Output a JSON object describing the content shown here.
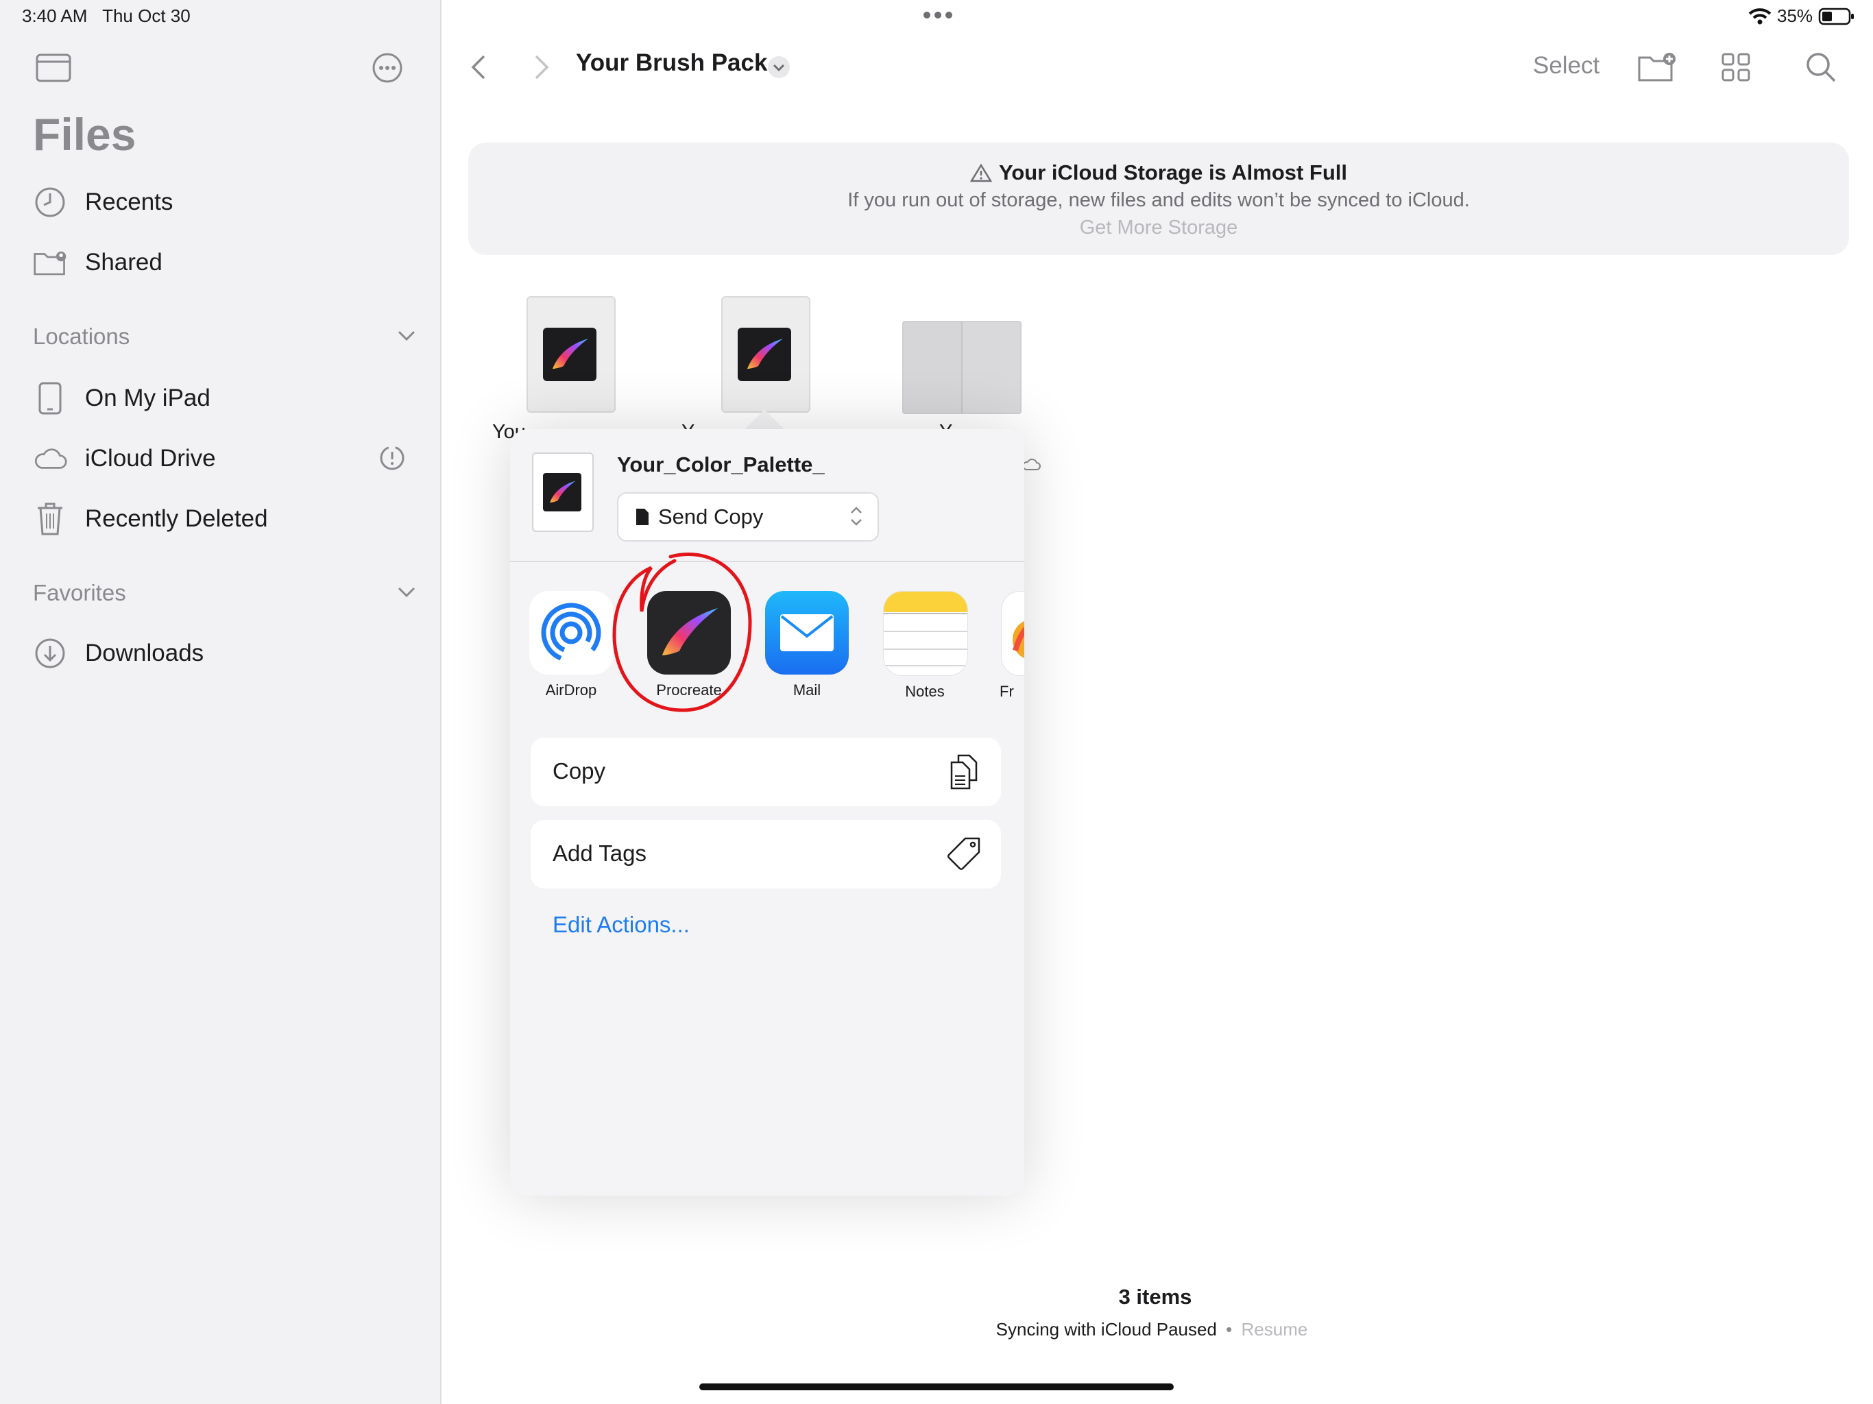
{
  "status_bar": {
    "time": "3:40 AM",
    "date": "Thu Oct 30",
    "battery": "35%"
  },
  "sidebar": {
    "title": "Files",
    "items_top": [
      {
        "label": "Recents",
        "icon": "clock-icon"
      },
      {
        "label": "Shared",
        "icon": "shared-folder-icon"
      }
    ],
    "locations": {
      "header": "Locations",
      "items": [
        {
          "label": "On My iPad",
          "icon": "ipad-icon"
        },
        {
          "label": "iCloud Drive",
          "icon": "cloud-icon"
        },
        {
          "label": "Recently Deleted",
          "icon": "trash-icon"
        }
      ]
    },
    "favorites": {
      "header": "Favorites",
      "items": [
        {
          "label": "Downloads",
          "icon": "download-icon"
        }
      ]
    }
  },
  "toolbar": {
    "title": "Your Brush Pack",
    "select_label": "Select"
  },
  "banner": {
    "title": "Your iCloud Storage is Almost Full",
    "message": "If you run out of storage, new files and edits won’t be synced to iCloud.",
    "action": "Get More Storage"
  },
  "files": [
    {
      "label": "You",
      "type": "procreate"
    },
    {
      "label": "Y",
      "type": "procreate"
    },
    {
      "label": "Y",
      "type": "folder-preview"
    }
  ],
  "share_sheet": {
    "file_name": "Your_Color_Palette_",
    "send_mode": "Send Copy",
    "apps": [
      {
        "label": "AirDrop",
        "icon": "airdrop-icon"
      },
      {
        "label": "Procreate",
        "icon": "procreate-icon"
      },
      {
        "label": "Mail",
        "icon": "mail-icon"
      },
      {
        "label": "Notes",
        "icon": "notes-icon"
      },
      {
        "label": "Fr",
        "icon": "freeform-icon"
      }
    ],
    "actions": [
      {
        "label": "Copy",
        "icon": "copy-icon"
      },
      {
        "label": "Add Tags",
        "icon": "tag-icon"
      }
    ],
    "edit_actions": "Edit Actions..."
  },
  "footer": {
    "items_count": "3 items",
    "sync_status": "Syncing with iCloud Paused",
    "separator": "•",
    "resume": "Resume"
  },
  "colors": {
    "accent_blue": "#1d7cf2",
    "annotation_red": "#e3151b",
    "sidebar_bg": "#f2f2f5"
  }
}
